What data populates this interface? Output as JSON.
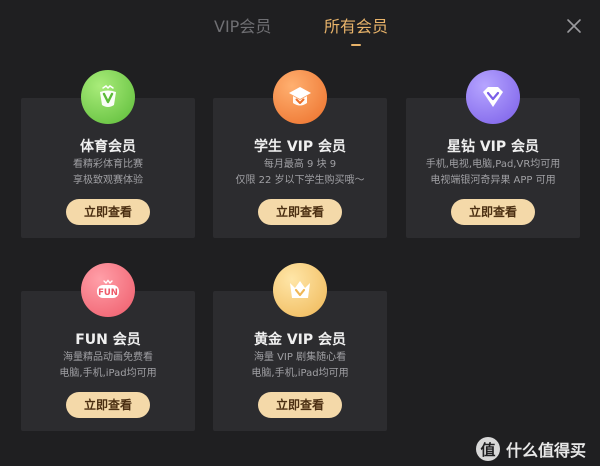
{
  "tabs": [
    {
      "label": "VIP会员",
      "active": false
    },
    {
      "label": "所有会员",
      "active": true
    }
  ],
  "colors": {
    "accent": "#e8b36a",
    "background": "#1f1f21",
    "card": "#2c2c2f",
    "button": "#f4d9a9"
  },
  "cards": [
    {
      "title": "体育会员",
      "desc": [
        "看精彩体育比赛",
        "享极致观赛体验"
      ],
      "button": "立即查看",
      "icon": "sports-v-icon"
    },
    {
      "title": "学生 VIP 会员",
      "desc": [
        "每月最高 9 块 9",
        "仅限 22 岁以下学生购买哦～"
      ],
      "button": "立即查看",
      "icon": "graduation-cap-icon"
    },
    {
      "title": "星钻 VIP 会员",
      "desc": [
        "手机,电视,电脑,Pad,VR均可用",
        "电视端银河奇异果 APP 可用"
      ],
      "button": "立即查看",
      "icon": "diamond-icon"
    },
    {
      "title": "FUN 会员",
      "desc": [
        "海量精品动画免费看",
        "电脑,手机,iPad均可用"
      ],
      "button": "立即查看",
      "icon": "fun-badge-icon",
      "icon_text": "FUN"
    },
    {
      "title": "黄金 VIP 会员",
      "desc": [
        "海量 VIP 剧集随心看",
        "电脑,手机,iPad均可用"
      ],
      "button": "立即查看",
      "icon": "gold-crown-icon"
    }
  ],
  "watermark": {
    "logo": "值",
    "text": "什么值得买"
  }
}
